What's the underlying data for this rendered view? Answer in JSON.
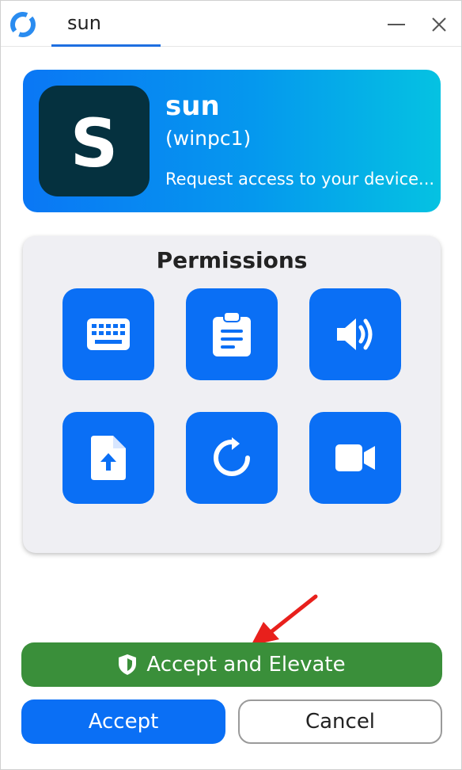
{
  "titlebar": {
    "tab_label": "sun",
    "logo_icon": "refresh-ring-logo",
    "minimize_icon": "minimize-icon",
    "close_icon": "close-icon"
  },
  "user": {
    "avatar_letter": "S",
    "name": "sun",
    "host": "(winpc1)",
    "request": "Request access to your device..."
  },
  "permissions": {
    "title": "Permissions",
    "items": [
      "keyboard-icon",
      "clipboard-icon",
      "audio-icon",
      "file-transfer-icon",
      "restart-icon",
      "video-camera-icon"
    ]
  },
  "actions": {
    "elevate_label": "Accept and Elevate",
    "accept_label": "Accept",
    "cancel_label": "Cancel"
  },
  "colors": {
    "accent_blue": "#0a6ff5",
    "avatar_bg": "#05313f",
    "elevate_green": "#3a8f3a",
    "panel_bg": "#efeff3",
    "annotation_red": "#e8201c"
  }
}
